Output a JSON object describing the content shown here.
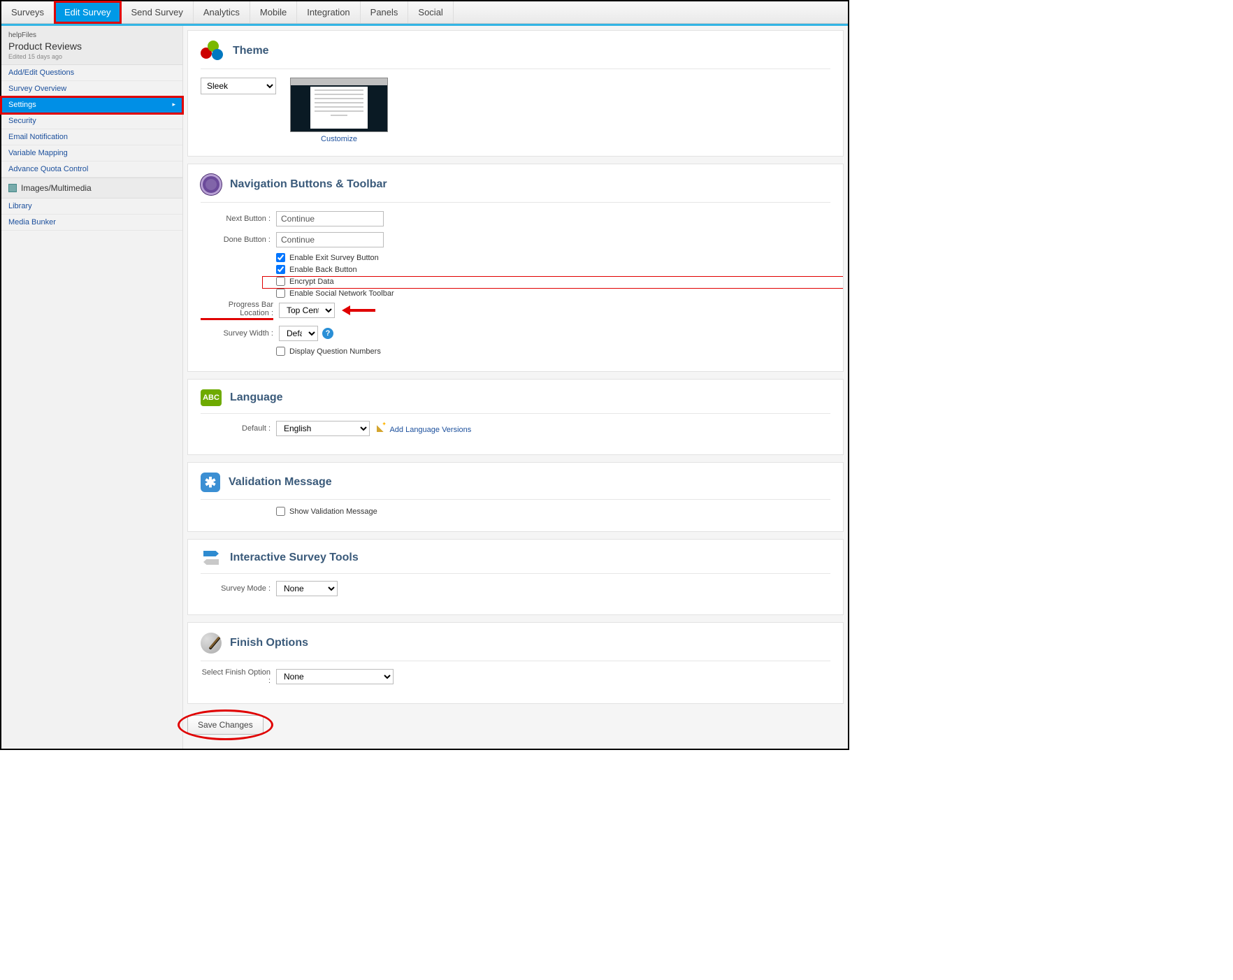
{
  "topnav": {
    "tabs": [
      {
        "label": "Surveys",
        "active": false
      },
      {
        "label": "Edit Survey",
        "active": true,
        "highlight": true
      },
      {
        "label": "Send Survey"
      },
      {
        "label": "Analytics"
      },
      {
        "label": "Mobile"
      },
      {
        "label": "Integration"
      },
      {
        "label": "Panels"
      },
      {
        "label": "Social"
      }
    ]
  },
  "sidebar": {
    "help_label": "helpFiles",
    "title": "Product Reviews",
    "edited": "Edited 15 days ago",
    "items": [
      {
        "label": "Add/Edit Questions"
      },
      {
        "label": "Survey Overview"
      },
      {
        "label": "Settings",
        "selected": true,
        "redbox": true
      },
      {
        "label": "Security"
      },
      {
        "label": "Email Notification"
      },
      {
        "label": "Variable Mapping"
      },
      {
        "label": "Advance Quota Control"
      }
    ],
    "group_label": "Images/Multimedia",
    "group_items": [
      {
        "label": "Library"
      },
      {
        "label": "Media Bunker"
      }
    ]
  },
  "panels": {
    "theme": {
      "title": "Theme",
      "select_value": "Sleek",
      "customize_label": "Customize"
    },
    "nav": {
      "title": "Navigation Buttons & Toolbar",
      "next_label": "Next Button :",
      "next_value": "Continue",
      "done_label": "Done Button :",
      "done_value": "Continue",
      "cb_exit": "Enable Exit Survey Button",
      "cb_back": "Enable Back Button",
      "cb_encrypt": "Encrypt Data",
      "cb_social": "Enable Social Network Toolbar",
      "progress_label": "Progress Bar Location :",
      "progress_value": "Top Center",
      "width_label": "Survey Width :",
      "width_value": "Default",
      "cb_qnum": "Display Question Numbers"
    },
    "lang": {
      "title": "Language",
      "default_label": "Default :",
      "default_value": "English",
      "add_label": "Add Language Versions",
      "lang_badge": "ABC"
    },
    "validation": {
      "title": "Validation Message",
      "cb_show": "Show Validation Message",
      "star": "✱"
    },
    "interactive": {
      "title": "Interactive Survey Tools",
      "mode_label": "Survey Mode :",
      "mode_value": "None"
    },
    "finish": {
      "title": "Finish Options",
      "select_label": "Select Finish Option :",
      "select_value": "None"
    }
  },
  "save_button": "Save Changes",
  "help_q": "?"
}
